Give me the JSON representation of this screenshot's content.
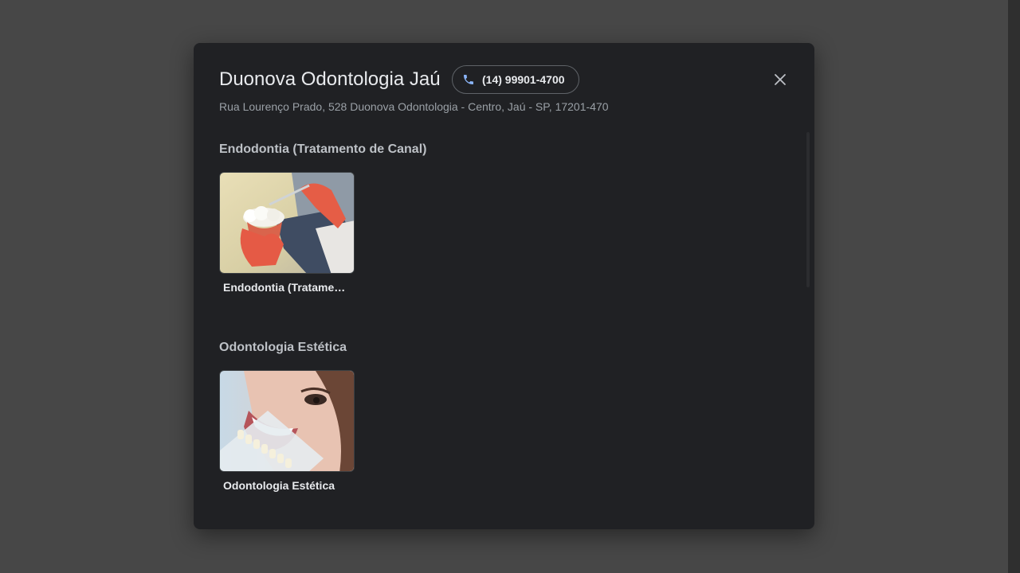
{
  "dialog": {
    "title": "Duonova Odontologia Jaú",
    "phone": "(14) 99901-4700",
    "address": "Rua Lourenço Prado, 528 Duonova Odontologia - Centro, Jaú - SP, 17201-470",
    "icons": {
      "phone": "phone-icon",
      "close": "close-icon"
    },
    "colors": {
      "background": "#202124",
      "phone_icon": "#8ab4f8",
      "title": "#e8eaed",
      "muted": "#9aa0a6"
    }
  },
  "sections": [
    {
      "heading": "Endodontia (Tratamento de Canal)",
      "items": [
        {
          "caption": "Endodontia (Tratamento de Canal)",
          "image": "dental-model-with-gloved-hands"
        }
      ]
    },
    {
      "heading": "Odontologia Estética",
      "items": [
        {
          "caption": "Odontologia Estética",
          "image": "smiling-woman-with-tooth-shade-guide"
        }
      ]
    }
  ]
}
